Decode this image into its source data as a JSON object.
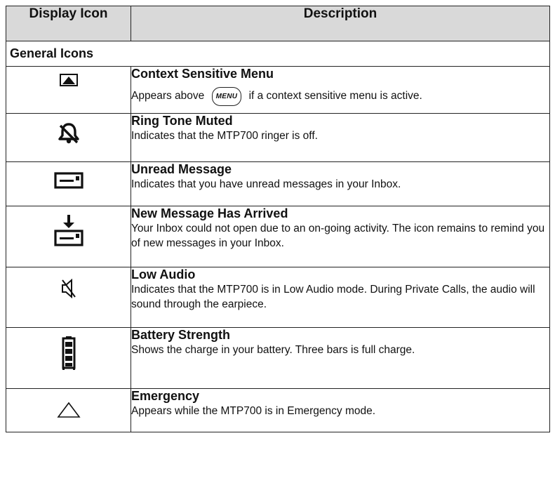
{
  "table": {
    "headers": {
      "icon": "Display Icon",
      "description": "Description"
    },
    "section_title": "General Icons",
    "rows": [
      {
        "icon": "context-menu-icon",
        "title": "Context Sensitive Menu",
        "text_before": "Appears above",
        "menu_key": "MENU",
        "text_after": "if a context sensitive menu is active."
      },
      {
        "icon": "ring-muted-icon",
        "title": "Ring Tone Muted",
        "text": "Indicates that the MTP700 ringer is off."
      },
      {
        "icon": "unread-message-icon",
        "title": "Unread Message",
        "text": "Indicates that you have unread messages in your Inbox."
      },
      {
        "icon": "new-message-icon",
        "title": "New Message Has Arrived",
        "text": "Your Inbox could not open due to an on-going activity. The icon remains to remind you of new messages in your Inbox."
      },
      {
        "icon": "low-audio-icon",
        "title": "Low Audio",
        "text": "Indicates that the  MTP700 is in Low Audio mode. During Private Calls, the audio will sound through the earpiece."
      },
      {
        "icon": "battery-icon",
        "title": "Battery Strength",
        "text": "Shows the charge in your battery. Three bars is full charge."
      },
      {
        "icon": "emergency-icon",
        "title": "Emergency",
        "text": "Appears while the  MTP700 is in Emergency mode."
      }
    ]
  }
}
